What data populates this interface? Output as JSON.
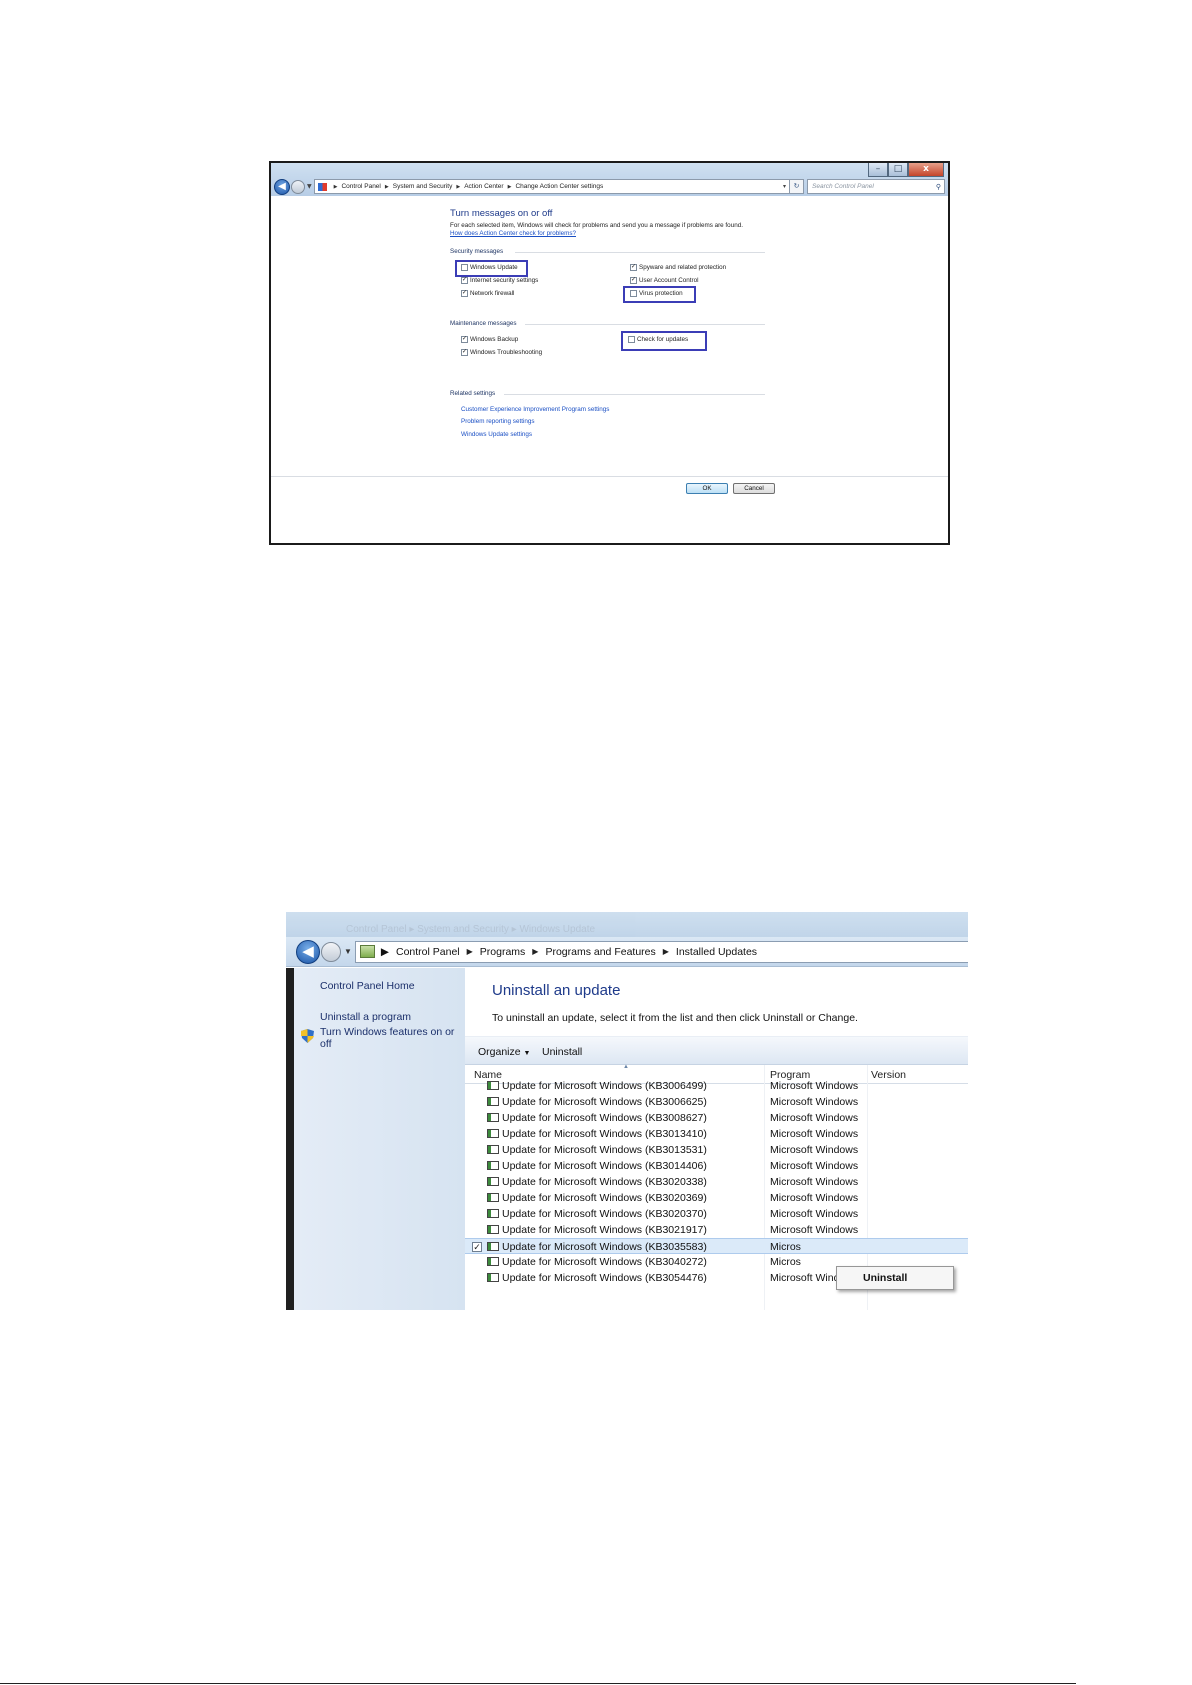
{
  "shot1": {
    "window_controls": {
      "minimize": "–",
      "maximize": "□",
      "close": "x"
    },
    "breadcrumbs": [
      "Control Panel",
      "System and Security",
      "Action Center",
      "Change Action Center settings"
    ],
    "search_placeholder": "Search Control Panel",
    "heading": "Turn messages on or off",
    "intro": "For each selected item, Windows will check for problems and send you a message if problems are found.",
    "intro_link": "How does Action Center check for problems?",
    "security_section": "Security messages",
    "security_items": [
      {
        "label": "Windows Update",
        "checked": false
      },
      {
        "label": "Spyware and related protection",
        "checked": true
      },
      {
        "label": "Internet security settings",
        "checked": true
      },
      {
        "label": "User Account Control",
        "checked": true
      },
      {
        "label": "Network firewall",
        "checked": true
      },
      {
        "label": "Virus protection",
        "checked": false
      }
    ],
    "maintenance_section": "Maintenance messages",
    "maintenance_items": [
      {
        "label": "Windows Backup",
        "checked": true
      },
      {
        "label": "Check for updates",
        "checked": false
      },
      {
        "label": "Windows Troubleshooting",
        "checked": true
      }
    ],
    "related_section": "Related settings",
    "related_links": [
      "Customer Experience Improvement Program settings",
      "Problem reporting settings",
      "Windows Update settings"
    ],
    "ok_label": "OK",
    "cancel_label": "Cancel",
    "highlight_color": "#3b3db6"
  },
  "shot2": {
    "ghost_title": "Control Panel ▸ System and Security ▸ Windows Update",
    "breadcrumbs": [
      "Control Panel",
      "Programs",
      "Programs and Features",
      "Installed Updates"
    ],
    "sidebar": {
      "home": "Control Panel Home",
      "uninstall_program": "Uninstall a program",
      "windows_features": "Turn Windows features on or off"
    },
    "title": "Uninstall an update",
    "description": "To uninstall an update, select it from the list and then click Uninstall or Change.",
    "toolbar": {
      "organize": "Organize",
      "uninstall": "Uninstall"
    },
    "columns": {
      "name": "Name",
      "program": "Program",
      "version": "Version"
    },
    "rows": [
      {
        "name": "Update for Microsoft Windows (KB3006499)",
        "program": "Microsoft Windows"
      },
      {
        "name": "Update for Microsoft Windows (KB3006625)",
        "program": "Microsoft Windows"
      },
      {
        "name": "Update for Microsoft Windows (KB3008627)",
        "program": "Microsoft Windows"
      },
      {
        "name": "Update for Microsoft Windows (KB3013410)",
        "program": "Microsoft Windows"
      },
      {
        "name": "Update for Microsoft Windows (KB3013531)",
        "program": "Microsoft Windows"
      },
      {
        "name": "Update for Microsoft Windows (KB3014406)",
        "program": "Microsoft Windows"
      },
      {
        "name": "Update for Microsoft Windows (KB3020338)",
        "program": "Microsoft Windows"
      },
      {
        "name": "Update for Microsoft Windows (KB3020369)",
        "program": "Microsoft Windows"
      },
      {
        "name": "Update for Microsoft Windows (KB3020370)",
        "program": "Microsoft Windows"
      },
      {
        "name": "Update for Microsoft Windows (KB3021917)",
        "program": "Microsoft Windows"
      },
      {
        "name": "Update for Microsoft Windows (KB3035583)",
        "program": "Micros",
        "selected": true
      },
      {
        "name": "Update for Microsoft Windows (KB3040272)",
        "program": "Micros"
      },
      {
        "name": "Update for Microsoft Windows (KB3054476)",
        "program": "Microsoft Windows"
      }
    ],
    "context_menu": {
      "uninstall": "Uninstall"
    }
  }
}
